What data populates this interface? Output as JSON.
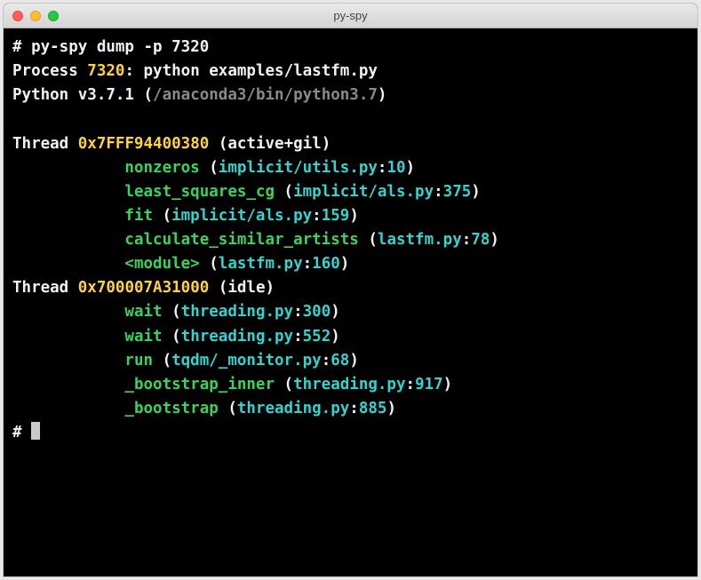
{
  "window": {
    "title": "py-spy"
  },
  "prompt": "# ",
  "command": "py-spy dump -p 7320",
  "process_line": {
    "prefix": "Process ",
    "pid": "7320",
    "rest": ": python examples/lastfm.py"
  },
  "python_line": {
    "prefix": "Python v3.7.1 (",
    "path": "/anaconda3/bin/python3.7",
    "suffix": ")"
  },
  "threads": [
    {
      "label": "Thread ",
      "id": "0x7FFF94400380",
      "state": " (active+gil)",
      "frames": [
        {
          "func": "nonzeros",
          "loc": "implicit/utils.py",
          "line": "10"
        },
        {
          "func": "least_squares_cg",
          "loc": "implicit/als.py",
          "line": "375"
        },
        {
          "func": "fit",
          "loc": "implicit/als.py",
          "line": "159"
        },
        {
          "func": "calculate_similar_artists",
          "loc": "lastfm.py",
          "line": "78"
        },
        {
          "func": "<module>",
          "loc": "lastfm.py",
          "line": "160"
        }
      ]
    },
    {
      "label": "Thread ",
      "id": "0x700007A31000",
      "state": " (idle)",
      "frames": [
        {
          "func": "wait",
          "loc": "threading.py",
          "line": "300"
        },
        {
          "func": "wait",
          "loc": "threading.py",
          "line": "552"
        },
        {
          "func": "run",
          "loc": "tqdm/_monitor.py",
          "line": "68"
        },
        {
          "func": "_bootstrap_inner",
          "loc": "threading.py",
          "line": "917"
        },
        {
          "func": "_bootstrap",
          "loc": "threading.py",
          "line": "885"
        }
      ]
    }
  ],
  "final_prompt": "# "
}
